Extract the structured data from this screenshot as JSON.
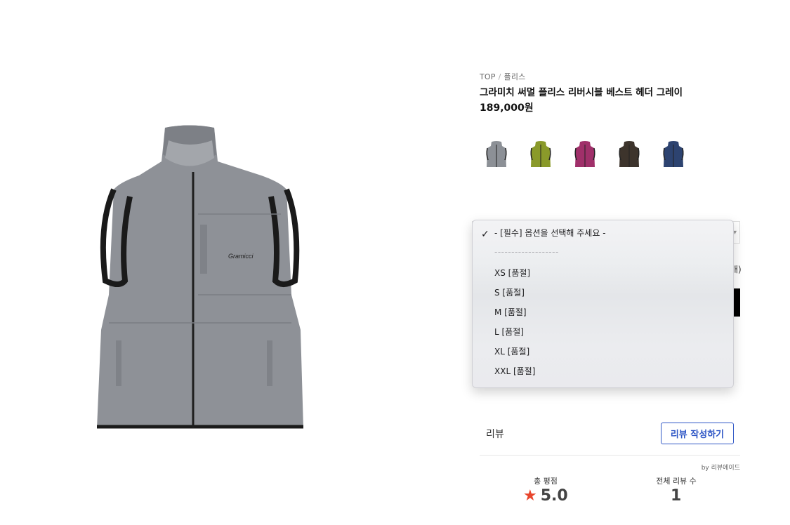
{
  "breadcrumb": {
    "root": "TOP",
    "separator": "/",
    "category": "플리스"
  },
  "product": {
    "title": "그라미치 써멀 플리스 리버시블 베스트 헤더 그레이",
    "price": "189,000원"
  },
  "swatches": [
    {
      "name": "gray",
      "color": "#8c9096"
    },
    {
      "name": "olive",
      "color": "#8a9a2a"
    },
    {
      "name": "magenta",
      "color": "#a0306a"
    },
    {
      "name": "brown",
      "color": "#3d342c"
    },
    {
      "name": "navy",
      "color": "#2d4370"
    }
  ],
  "dropdown": {
    "selected": "- [필수] 옵션을 선택해 주세요 -",
    "separator": "-------------------",
    "options": [
      "XS [품절]",
      "S [품절]",
      "M [품절]",
      "L [품절]",
      "XL [품절]",
      "XXL [품절]"
    ]
  },
  "under": {
    "partial_text": "개)"
  },
  "reviews": {
    "label": "리뷰",
    "write_button": "리뷰 작성하기",
    "byline": "by 리뷰에이드",
    "rating_label": "총 평점",
    "rating_value": "5.0",
    "count_label": "전체 리뷰 수",
    "count_value": "1",
    "star_color": "#e8452c"
  }
}
